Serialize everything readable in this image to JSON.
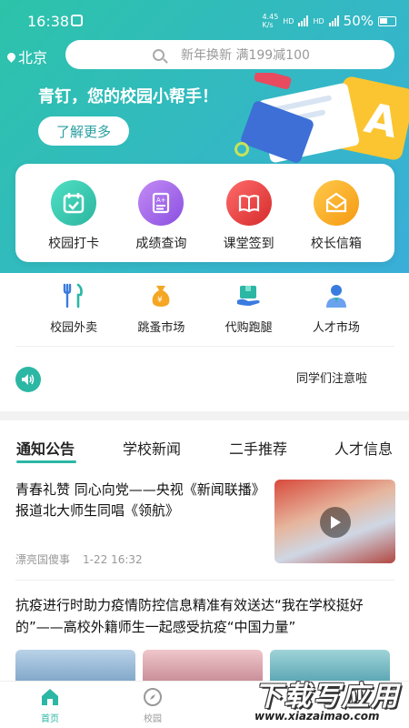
{
  "status_bar": {
    "time": "16:38",
    "net_speed_top": "4.45",
    "net_speed_bottom": "K/s",
    "battery": "50%"
  },
  "header": {
    "city": "北京",
    "search_placeholder": "新年换新 满199减100"
  },
  "banner": {
    "title": "青钉，您的校园小帮手！",
    "button_label": "了解更多"
  },
  "features": [
    {
      "label": "校园打卡",
      "icon": "calendar-check-icon",
      "color": "#2cc3a9"
    },
    {
      "label": "成绩查询",
      "icon": "grade-document-icon",
      "color": "#9b5de5"
    },
    {
      "label": "课堂签到",
      "icon": "open-book-icon",
      "color": "#e63b3b"
    },
    {
      "label": "校长信箱",
      "icon": "envelope-icon",
      "color": "#f5a623"
    }
  ],
  "services": [
    {
      "label": "校园外卖",
      "icon": "fork-knife-icon"
    },
    {
      "label": "跳蚤市场",
      "icon": "money-bag-icon"
    },
    {
      "label": "代购跑腿",
      "icon": "delivery-box-icon"
    },
    {
      "label": "人才市场",
      "icon": "person-icon"
    }
  ],
  "notice": {
    "text": "同学们注意啦"
  },
  "tabs": [
    "通知公告",
    "学校新闻",
    "二手推荐",
    "人才信息"
  ],
  "news": [
    {
      "title": "青春礼赞 同心向党——央视《新闻联播》报道北大师生同唱《领航》",
      "source": "漂亮国傻事",
      "time": "1-22 16:32"
    },
    {
      "title": "抗疫进行时助力疫情防控信息精准有效送达“我在学校挺好的”——高校外籍师生一起感受抗疫“中国力量”"
    }
  ],
  "bottom_nav": [
    {
      "label": "首页",
      "active": true
    },
    {
      "label": "校园",
      "active": false
    }
  ],
  "watermark": {
    "text": "下载写应用",
    "url": "www.xiazaimao.com"
  },
  "colors": {
    "accent": "#2bb7a4",
    "gradient_start": "#2cc3a9",
    "gradient_end": "#3aaed8"
  }
}
